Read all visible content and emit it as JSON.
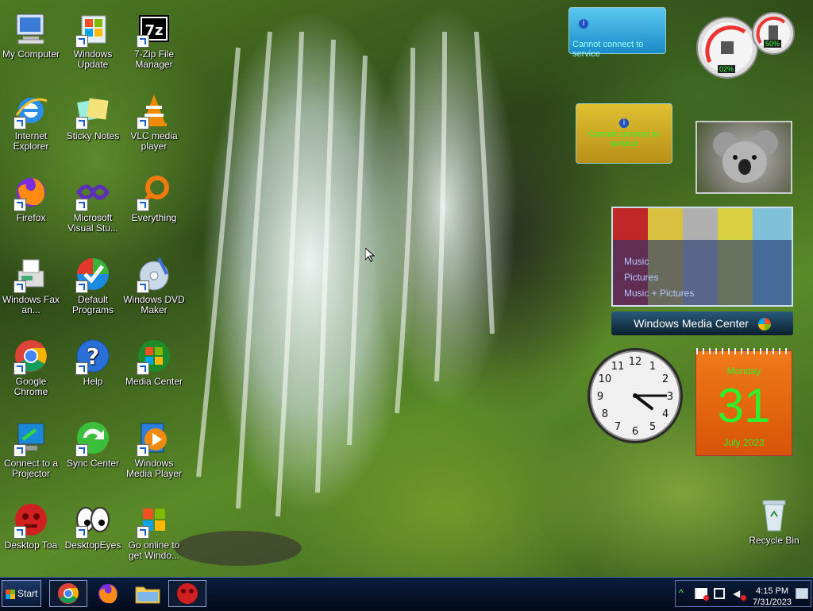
{
  "desktop": {
    "icons": [
      {
        "label": "My Computer",
        "icon": "computer-icon"
      },
      {
        "label": "Windows Update",
        "icon": "windows-update-icon"
      },
      {
        "label": "7-Zip File Manager",
        "icon": "7zip-icon",
        "glyph": "7z"
      },
      {
        "label": "Internet Explorer",
        "icon": "ie-icon"
      },
      {
        "label": "Sticky Notes",
        "icon": "sticky-notes-icon"
      },
      {
        "label": "VLC media player",
        "icon": "vlc-icon"
      },
      {
        "label": "Firefox",
        "icon": "firefox-icon"
      },
      {
        "label": "Microsoft Visual Stu...",
        "icon": "visual-studio-icon"
      },
      {
        "label": "Everything",
        "icon": "everything-icon"
      },
      {
        "label": "Windows Fax an...",
        "icon": "fax-icon"
      },
      {
        "label": "Default Programs",
        "icon": "default-programs-icon"
      },
      {
        "label": "Windows DVD Maker",
        "icon": "dvd-maker-icon"
      },
      {
        "label": "Google Chrome",
        "icon": "chrome-icon"
      },
      {
        "label": "Help",
        "icon": "help-icon",
        "glyph": "?"
      },
      {
        "label": "Media Center",
        "icon": "media-center-icon"
      },
      {
        "label": "Connect to a Projector",
        "icon": "projector-icon"
      },
      {
        "label": "Sync Center",
        "icon": "sync-center-icon"
      },
      {
        "label": "Windows Media Player",
        "icon": "media-player-icon"
      },
      {
        "label": "Desktop Toa",
        "icon": "desktop-toa-icon"
      },
      {
        "label": "DesktopEyes",
        "icon": "desktop-eyes-icon"
      },
      {
        "label": "Go online to get Windo...",
        "icon": "windows-online-icon"
      },
      {
        "label": "Recycle Bin",
        "icon": "recycle-bin-icon"
      }
    ]
  },
  "gadgets": {
    "weather": {
      "message": "Cannot connect to service"
    },
    "currency": {
      "message": "Cannot connect to service"
    },
    "cpu_meter": {
      "cpu": "02%",
      "memory": "50%"
    },
    "media_center": {
      "items": [
        "Music",
        "Pictures",
        "Music + Pictures"
      ],
      "brand": "Windows Media Center"
    },
    "clock": {
      "hour": 4,
      "minute": 15,
      "numbers": [
        "12",
        "1",
        "2",
        "3",
        "4",
        "5",
        "6",
        "7",
        "8",
        "9",
        "10",
        "11"
      ]
    },
    "calendar": {
      "weekday": "Monday",
      "day": "31",
      "month_year": "July 2023"
    }
  },
  "taskbar": {
    "start_label": "Start",
    "time": "4:15 PM",
    "date": "7/31/2023",
    "apps": [
      "chrome-icon",
      "firefox-icon",
      "explorer-folder-icon",
      "desktop-toa-icon"
    ]
  },
  "colors": {
    "taskbar": "#030b1c",
    "calendar_bg": "#e8600a",
    "calendar_day": "#3ee03e",
    "notice_text": "#99ffff"
  }
}
